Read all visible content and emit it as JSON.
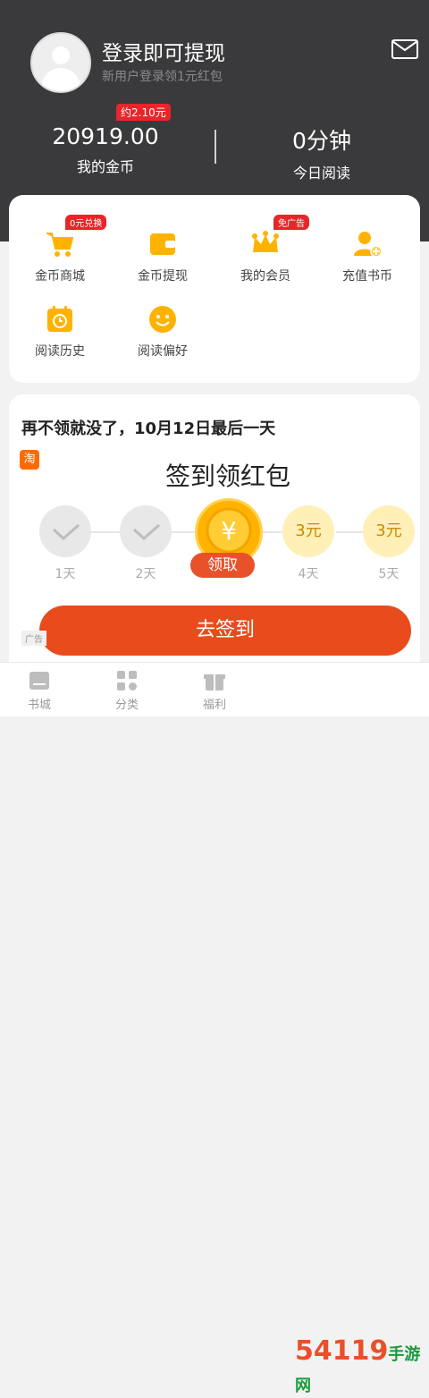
{
  "header": {
    "login_title": "登录即可提现",
    "login_subtitle": "新用户登录领1元红包",
    "coins": {
      "value": "20919.00",
      "label": "我的金币",
      "badge": "约2.10元"
    },
    "reading": {
      "value": "0分钟",
      "label": "今日阅读"
    }
  },
  "menu": {
    "items": [
      {
        "label": "金币商城",
        "icon": "cart-icon",
        "badge": "0元兑换"
      },
      {
        "label": "金币提现",
        "icon": "wallet-icon"
      },
      {
        "label": "我的会员",
        "icon": "crown-icon",
        "badge": "免广告"
      },
      {
        "label": "充值书币",
        "icon": "user-add-icon"
      },
      {
        "label": "阅读历史",
        "icon": "history-icon"
      },
      {
        "label": "阅读偏好",
        "icon": "smile-icon"
      }
    ]
  },
  "signin": {
    "notice": "再不领就没了，10月12日最后一天",
    "taobao": "淘",
    "title": "签到领红包",
    "days": [
      {
        "label": "1天",
        "state": "done"
      },
      {
        "label": "2天",
        "state": "done"
      },
      {
        "label": "",
        "state": "today",
        "claim": "领取",
        "symbol": "¥"
      },
      {
        "label": "4天",
        "state": "future",
        "amount": "3元"
      },
      {
        "label": "5天",
        "state": "future",
        "amount": "3元"
      }
    ],
    "button": "去签到",
    "ad": "广告"
  },
  "tabs": [
    {
      "label": "书城",
      "icon": "bookstore-icon"
    },
    {
      "label": "分类",
      "icon": "category-icon"
    },
    {
      "label": "福利",
      "icon": "gift-icon"
    }
  ],
  "watermark": {
    "main": "54119",
    "sub": "手游网"
  },
  "colors": {
    "accent": "#e84c1c",
    "header": "#3a3a3c",
    "gold": "#ffb300",
    "badge": "#e8262a"
  }
}
